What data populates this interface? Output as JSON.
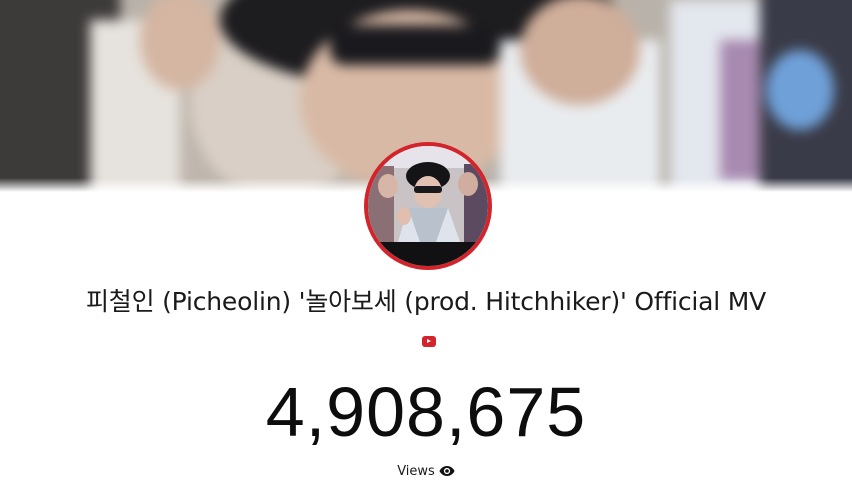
{
  "video": {
    "title": "피철인 (Picheolin) '놀아보세 (prod. Hitchhiker)' Official MV",
    "platform_icon": "youtube-icon",
    "view_count": "4,908,675",
    "views_label": "Views",
    "views_icon": "eye-icon"
  },
  "colors": {
    "accent": "#d3242b",
    "text": "#0d0d0d",
    "background": "#ffffff"
  }
}
